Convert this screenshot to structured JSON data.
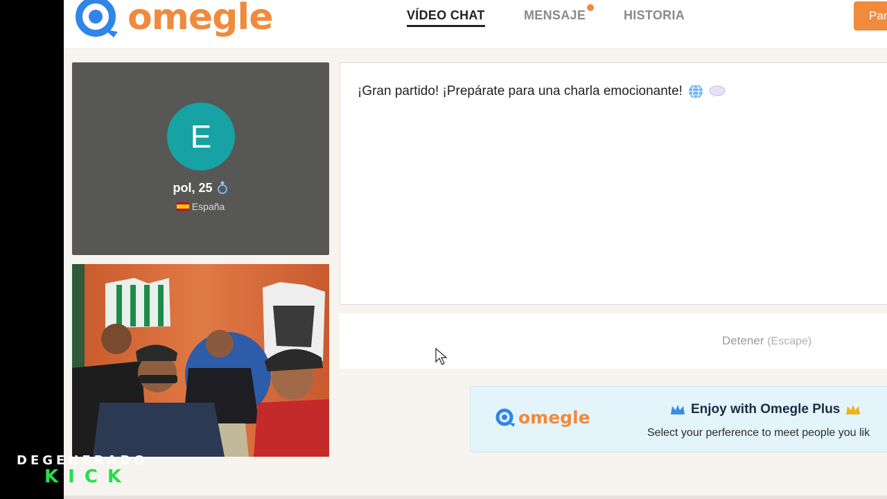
{
  "header": {
    "logo_text": "omegle",
    "nav": [
      {
        "label": "VÍDEO CHAT",
        "active": true
      },
      {
        "label": "MENSAJE",
        "active": false,
        "has_notification": true
      },
      {
        "label": "HISTORIA",
        "active": false
      }
    ],
    "cta_label": "Par"
  },
  "partner": {
    "avatar_initial": "E",
    "name_age": "pol, 25",
    "country": "España",
    "avatar_color": "#17a2a3"
  },
  "chat": {
    "message": "¡Gran partido! ¡Prepárate para una charla emocionante!"
  },
  "controls": {
    "stop_label": "Detener",
    "stop_hint": "(Escape)"
  },
  "promo": {
    "logo_text": "omegle",
    "title": "Enjoy with Omegle Plus",
    "subtitle": "Select your perference to meet people you lik"
  },
  "watermark": {
    "line1": "DEGENERADO",
    "line2": "KICK"
  },
  "colors": {
    "brand_orange": "#f08a3c",
    "brand_blue": "#2f86e8",
    "kick_green": "#23e04a"
  }
}
